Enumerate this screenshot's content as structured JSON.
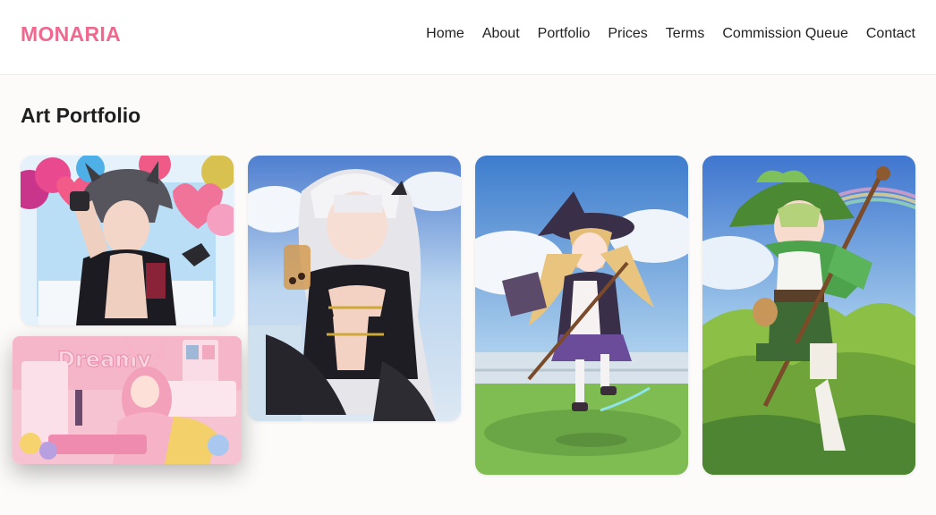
{
  "header": {
    "logo": "MONARIA",
    "nav": [
      "Home",
      "About",
      "Portfolio",
      "Prices",
      "Terms",
      "Commission Queue",
      "Contact"
    ]
  },
  "main": {
    "title": "Art Portfolio"
  },
  "gallery": {
    "items": [
      {
        "subject": "wolf-boy with heart balloons"
      },
      {
        "subject": "pink bunny-girl streamer room"
      },
      {
        "subject": "silver-haired girl with bubble tea"
      },
      {
        "subject": "little witch with staff on grass"
      },
      {
        "subject": "leaf-hat elf boy with staff"
      }
    ]
  },
  "colors": {
    "brand": "#f0678f",
    "background": "#fcfbfa"
  }
}
